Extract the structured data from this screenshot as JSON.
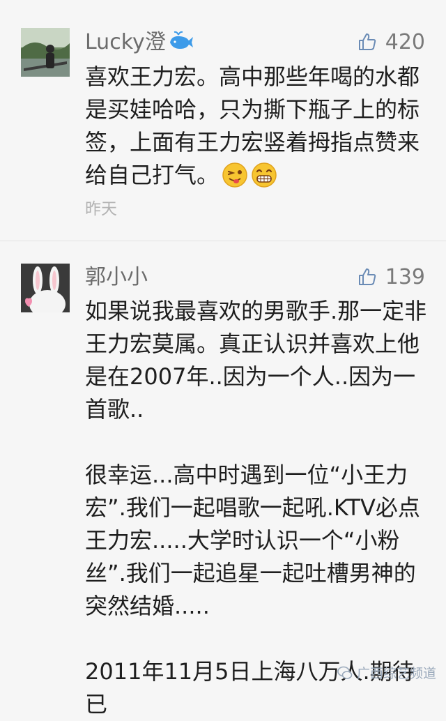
{
  "comments": [
    {
      "username": "Lucky澄",
      "likes": "420",
      "text": "喜欢王力宏。高中那些年喝的水都\n是买娃哈哈，只为撕下瓶子上的标\n签，上面有王力宏竖着拇指点赞来\n给自己打气。",
      "emojis": [
        "wink-tongue-emoji",
        "grin-emoji"
      ],
      "time": "昨天"
    },
    {
      "username": "郭小小",
      "likes": "139",
      "paragraphs": [
        "如果说我最喜欢的男歌手.那一定非\n王力宏莫属。真正认识并喜欢上他\n是在2007年..因为一个人..因为一\n首歌..",
        "很幸运...高中时遇到一位“小王力\n宏”.我们一起唱歌一起吼.KTV必点\n王力宏.....大学时认识一个“小粉\n丝”.我们一起追星一起吐槽男神的\n突然结婚.....",
        "2011年11月5日上海八万人.期待已"
      ]
    }
  ],
  "watermark": "广西综艺频道",
  "colors": {
    "background": "#f6f6f6",
    "username": "#6b6b6b",
    "like": "#7a7a7a",
    "time": "#b3b3b3"
  }
}
